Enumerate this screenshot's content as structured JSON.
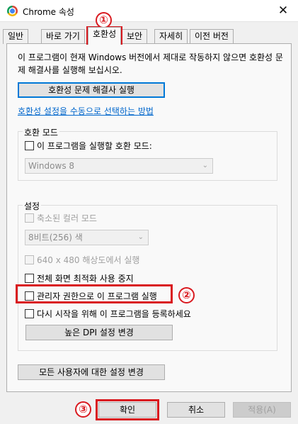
{
  "window": {
    "title": "Chrome 속성",
    "close_glyph": "✕"
  },
  "tabs": [
    {
      "label": "일반"
    },
    {
      "label": "바로 가기"
    },
    {
      "label": "호환성"
    },
    {
      "label": "보안"
    },
    {
      "label": "자세히"
    },
    {
      "label": "이전 버전"
    }
  ],
  "compat": {
    "intro": "이 프로그램이 현재 Windows 버전에서 제대로 작동하지 않으면 호환성 문제 해결사를 실행해 보십시오.",
    "troubleshooter_button": "호환성 문제 해결사 실행",
    "manual_link": "호환성 설정을 수동으로 선택하는 방법"
  },
  "compat_mode": {
    "legend": "호환 모드",
    "checkbox_label": "이 프로그램을 실행할 호환 모드:",
    "checked": false,
    "select_value": "Windows 8"
  },
  "settings": {
    "legend": "설정",
    "reduced_color": "축소된 컬러 모드",
    "color_select": "8비트(256) 색",
    "low_res": "640 x 480 해상도에서 실행",
    "disable_fullscreen": "전체 화면 최적화 사용 중지",
    "run_as_admin": "관리자 권한으로 이 프로그램 실행",
    "register_restart": "다시 시작을 위해 이 프로그램을 등록하세요",
    "dpi_button": "높은 DPI 설정 변경"
  },
  "all_users_button": "모든 사용자에 대한 설정 변경",
  "footer": {
    "ok": "확인",
    "cancel": "취소",
    "apply": "적용(A)"
  },
  "callouts": [
    "①",
    "②",
    "③"
  ],
  "colors": {
    "highlight": "#d9191f",
    "link": "#0066cc",
    "focus": "#0078d7"
  }
}
